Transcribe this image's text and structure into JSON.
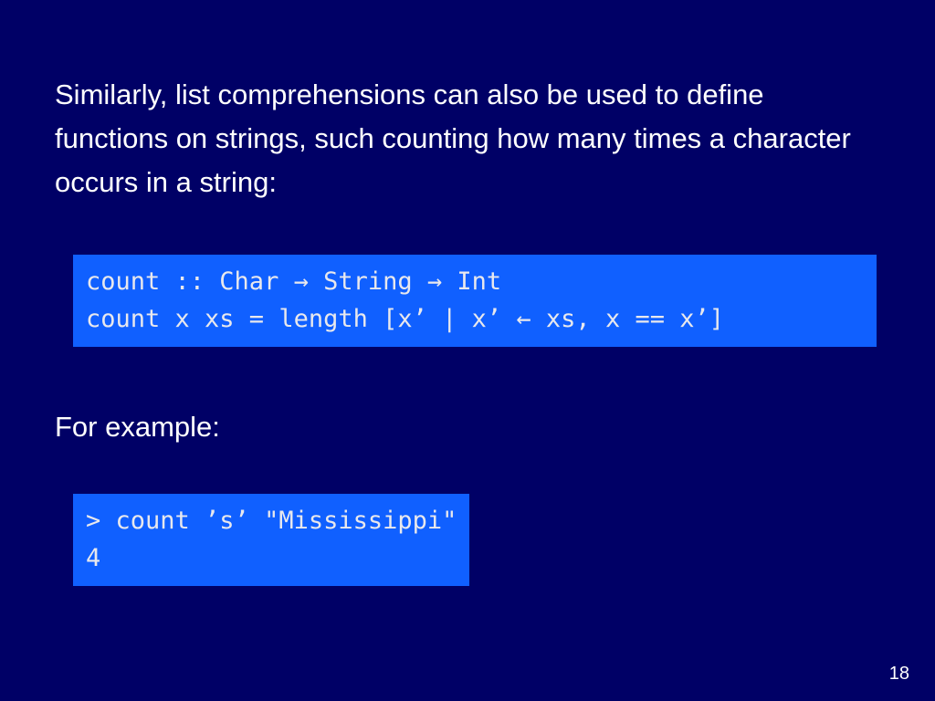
{
  "intro": "Similarly, list comprehensions can also be used to define functions on strings, such counting how many times a character occurs in a string:",
  "code1_line1": "count :: Char → String → Int",
  "code1_line2": "count x xs = length [x’ | x’ ← xs, x == x’]",
  "subhead": "For example:",
  "code2_line1": "> count ’s’ \"Mississippi\"",
  "code2_line2": "4",
  "page_number": "18"
}
